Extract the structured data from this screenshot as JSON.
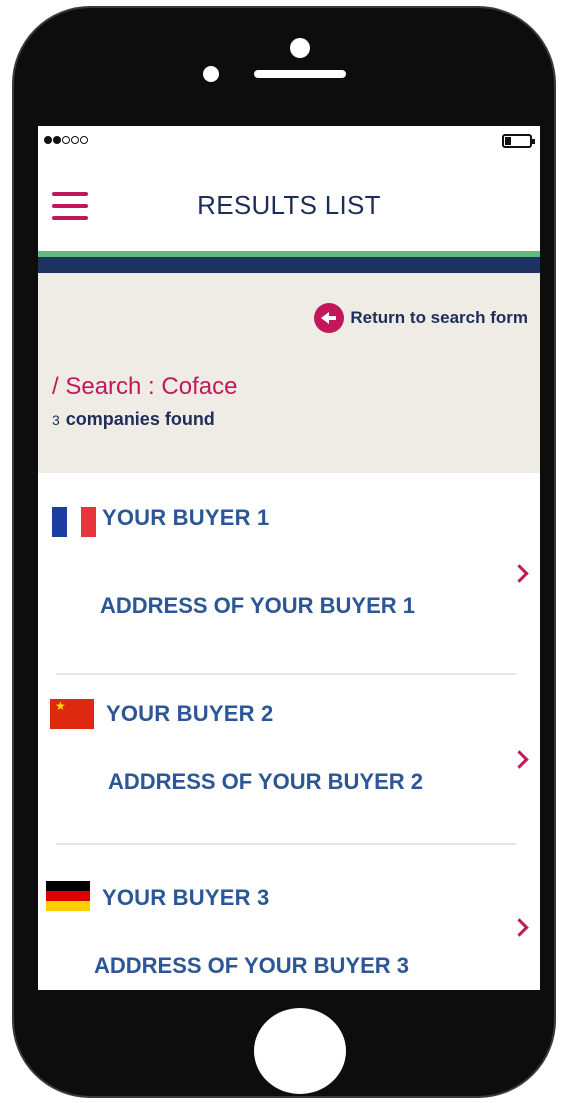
{
  "status": {
    "signal": "●●○○○"
  },
  "header": {
    "title": "RESULTS LIST"
  },
  "search": {
    "return_label": "Return to search form",
    "title": "/ Search : Coface",
    "count": "3",
    "count_text": "companies found"
  },
  "results": [
    {
      "name": "YOUR  BUYER 1",
      "address": "ADDRESS OF YOUR BUYER 1",
      "flag": "France"
    },
    {
      "name": "YOUR  BUYER 2",
      "address": "ADDRESS OF YOUR BUYER 2",
      "flag": "China"
    },
    {
      "name": "YOUR  BUYER 3",
      "address": "ADDRESS OF YOUR BUYER 3",
      "flag": "Germany"
    }
  ],
  "colors": {
    "accent": "#c2185b",
    "navy": "#1e3260",
    "green": "#5fba7d",
    "link": "#2b5797",
    "panel": "#efece6"
  }
}
